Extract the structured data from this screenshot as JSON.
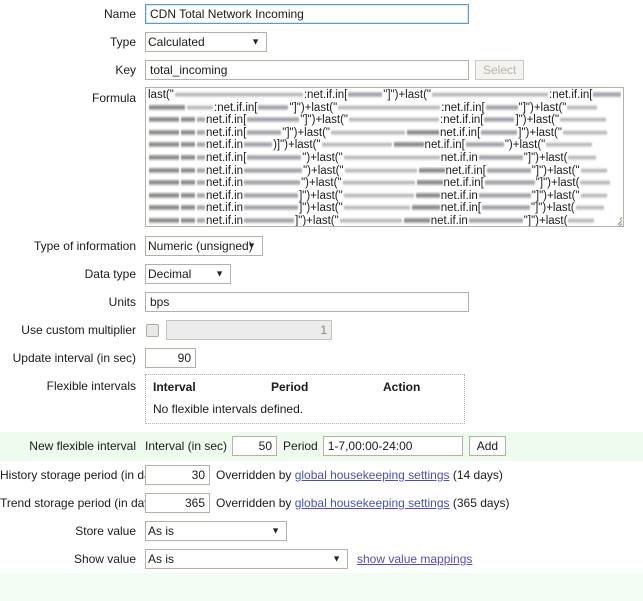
{
  "form": {
    "name": {
      "label": "Name",
      "value": "CDN Total Network Incoming"
    },
    "type": {
      "label": "Type",
      "value": "Calculated"
    },
    "key": {
      "label": "Key",
      "value": "total_incoming",
      "select_button": "Select"
    },
    "formula": {
      "label": "Formula",
      "redacted": true,
      "visible_tokens": [
        "last(\"",
        "net.if.in[",
        "\")",
        "+last(\"",
        ":net.if.in[",
        "\"]\")",
        ")"
      ],
      "lines": 13
    },
    "type_of_information": {
      "label": "Type of information",
      "value": "Numeric (unsigned)"
    },
    "data_type": {
      "label": "Data type",
      "value": "Decimal"
    },
    "units": {
      "label": "Units",
      "value": "bps"
    },
    "custom_multiplier": {
      "label": "Use custom multiplier",
      "checked": false,
      "value": "1",
      "disabled": true
    },
    "update_interval": {
      "label": "Update interval (in sec)",
      "value": "90"
    },
    "flexible_intervals": {
      "label": "Flexible intervals",
      "columns": [
        "Interval",
        "Period",
        "Action"
      ],
      "empty_text": "No flexible intervals defined.",
      "rows": []
    },
    "new_flexible_interval": {
      "label": "New flexible interval",
      "interval_label": "Interval (in sec)",
      "interval_value": "50",
      "period_label": "Period",
      "period_value": "1-7,00:00-24:00",
      "add_button": "Add"
    },
    "history_storage": {
      "label": "History storage period (in days)",
      "value": "30",
      "hint_prefix": "Overridden by",
      "hint_link": "global housekeeping settings",
      "hint_suffix": "(14 days)"
    },
    "trend_storage": {
      "label": "Trend storage period (in days)",
      "value": "365",
      "hint_prefix": "Overridden by",
      "hint_link": "global housekeeping settings",
      "hint_suffix": "(365 days)"
    },
    "store_value": {
      "label": "Store value",
      "value": "As is"
    },
    "show_value": {
      "label": "Show value",
      "value": "As is",
      "mappings_link": "show value mappings"
    }
  },
  "colors": {
    "highlight_row": "#eefbee",
    "field_border": "#b5b0a5",
    "focus_border": "#5c9ccc",
    "link": "#5b4ab5"
  }
}
